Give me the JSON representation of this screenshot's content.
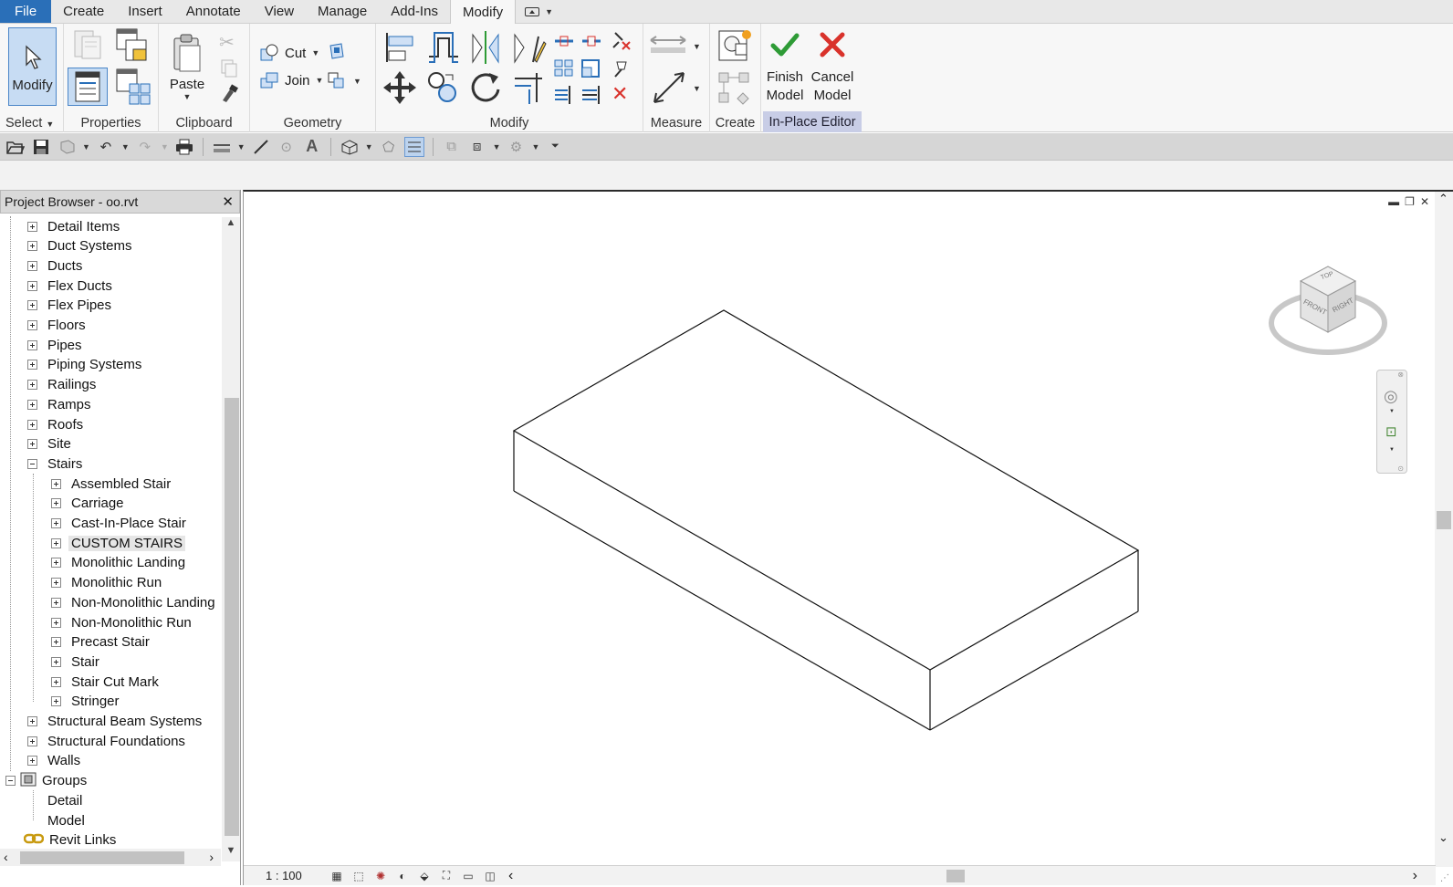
{
  "menu": {
    "tabs": [
      "File",
      "Create",
      "Insert",
      "Annotate",
      "View",
      "Manage",
      "Add-Ins",
      "Modify"
    ],
    "active": "Modify"
  },
  "ribbon": {
    "select": {
      "modify_label": "Modify",
      "panel": "Select"
    },
    "properties": {
      "panel": "Properties"
    },
    "clipboard": {
      "paste": "Paste",
      "panel": "Clipboard"
    },
    "geometry": {
      "cut": "Cut",
      "join": "Join",
      "panel": "Geometry"
    },
    "modify": {
      "panel": "Modify"
    },
    "measure": {
      "panel": "Measure"
    },
    "create": {
      "panel": "Create"
    },
    "inplace": {
      "finish": "Finish\nModel",
      "finish_l1": "Finish",
      "finish_l2": "Model",
      "cancel_l1": "Cancel",
      "cancel_l2": "Model",
      "panel": "In-Place Editor"
    }
  },
  "browser": {
    "title": "Project Browser - oo.rvt",
    "close": "✕",
    "items": [
      {
        "label": "Detail Items",
        "level": 1,
        "box": "plus"
      },
      {
        "label": "Duct Systems",
        "level": 1,
        "box": "plus"
      },
      {
        "label": "Ducts",
        "level": 1,
        "box": "plus"
      },
      {
        "label": "Flex Ducts",
        "level": 1,
        "box": "plus"
      },
      {
        "label": "Flex Pipes",
        "level": 1,
        "box": "plus"
      },
      {
        "label": "Floors",
        "level": 1,
        "box": "plus"
      },
      {
        "label": "Pipes",
        "level": 1,
        "box": "plus"
      },
      {
        "label": "Piping Systems",
        "level": 1,
        "box": "plus"
      },
      {
        "label": "Railings",
        "level": 1,
        "box": "plus"
      },
      {
        "label": "Ramps",
        "level": 1,
        "box": "plus"
      },
      {
        "label": "Roofs",
        "level": 1,
        "box": "plus"
      },
      {
        "label": "Site",
        "level": 1,
        "box": "plus"
      },
      {
        "label": "Stairs",
        "level": 1,
        "box": "minus"
      },
      {
        "label": "Assembled Stair",
        "level": 2,
        "box": "plus"
      },
      {
        "label": "Carriage",
        "level": 2,
        "box": "plus"
      },
      {
        "label": "Cast-In-Place Stair",
        "level": 2,
        "box": "plus"
      },
      {
        "label": "CUSTOM STAIRS",
        "level": 2,
        "box": "plus",
        "selected": true
      },
      {
        "label": "Monolithic Landing",
        "level": 2,
        "box": "plus"
      },
      {
        "label": "Monolithic Run",
        "level": 2,
        "box": "plus"
      },
      {
        "label": "Non-Monolithic Landing",
        "level": 2,
        "box": "plus"
      },
      {
        "label": "Non-Monolithic Run",
        "level": 2,
        "box": "plus"
      },
      {
        "label": "Precast Stair",
        "level": 2,
        "box": "plus"
      },
      {
        "label": "Stair",
        "level": 2,
        "box": "plus"
      },
      {
        "label": "Stair Cut Mark",
        "level": 2,
        "box": "plus"
      },
      {
        "label": "Stringer",
        "level": 2,
        "box": "plus"
      },
      {
        "label": "Structural Beam Systems",
        "level": 1,
        "box": "plus"
      },
      {
        "label": "Structural Foundations",
        "level": 1,
        "box": "plus"
      },
      {
        "label": "Walls",
        "level": 1,
        "box": "plus"
      },
      {
        "label": "Groups",
        "level": 0,
        "box": "minus",
        "icon": "group-icon"
      },
      {
        "label": "Detail",
        "level": 1,
        "box": "none"
      },
      {
        "label": "Model",
        "level": 1,
        "box": "none"
      },
      {
        "label": "Revit Links",
        "level": 0,
        "box": "none",
        "icon": "link-icon"
      }
    ]
  },
  "view": {
    "scale": "1 : 100",
    "viewcube": {
      "top": "TOP",
      "front": "FRONT",
      "right": "RIGHT"
    }
  },
  "colors": {
    "file_tab": "#2a6fb8",
    "editor_panel": "#c8cde6",
    "finish_green": "#2e9b36",
    "cancel_red": "#d9322b"
  }
}
